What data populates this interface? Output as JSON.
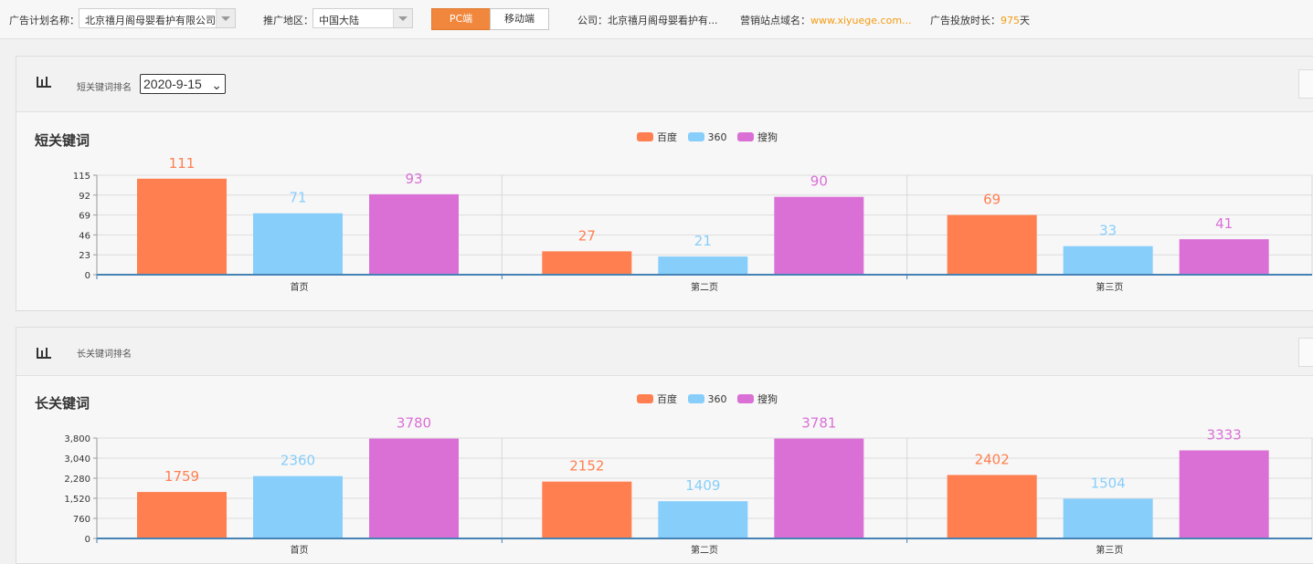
{
  "topbar": {
    "plan_label": "广告计划名称：",
    "plan_value": "北京禧月阁母婴看护有限公司(",
    "region_label": "推广地区：",
    "region_value": "中国大陆",
    "tab_pc": "PC端",
    "tab_mobile": "移动端",
    "company_label": "公司：",
    "company_value": "北京禧月阁母婴看护有...",
    "domain_label": "营销站点域名：",
    "domain_value": "www.xiyuege.com...",
    "duration_label": "广告投放时长：",
    "duration_days": "975",
    "duration_unit": "天"
  },
  "panels": [
    {
      "head_label": "短关键词排名",
      "date_value": "2020-9-15",
      "chevron": "⌄",
      "chart_icon": "bar-chart-icon"
    },
    {
      "head_label": "长关键词排名",
      "chart_icon": "bar-chart-icon"
    }
  ],
  "colors": {
    "baidu": "#ff7f50",
    "s360": "#87cefa",
    "sogou": "#da70d6",
    "accent": "#f0873d",
    "axis": "#4682b4"
  },
  "chart_data": [
    {
      "type": "bar",
      "title": "短关键词",
      "categories": [
        "首页",
        "第二页",
        "第三页"
      ],
      "series": [
        {
          "name": "百度",
          "values": [
            111,
            27,
            69
          ]
        },
        {
          "name": "360",
          "values": [
            71,
            21,
            33
          ]
        },
        {
          "name": "搜狗",
          "values": [
            93,
            90,
            41
          ]
        }
      ],
      "ylim": [
        0,
        115
      ],
      "yticks": [
        0,
        23,
        46,
        69,
        92,
        115
      ],
      "ytick_labels": [
        "0",
        "23",
        "46",
        "69",
        "92",
        "115"
      ],
      "legend": "top-center",
      "grid": true
    },
    {
      "type": "bar",
      "title": "长关键词",
      "categories": [
        "首页",
        "第二页",
        "第三页"
      ],
      "series": [
        {
          "name": "百度",
          "values": [
            1759,
            2152,
            2402
          ]
        },
        {
          "name": "360",
          "values": [
            2360,
            1409,
            1504
          ]
        },
        {
          "name": "搜狗",
          "values": [
            3780,
            3781,
            3333
          ]
        }
      ],
      "ylim": [
        0,
        3800
      ],
      "yticks": [
        0,
        760,
        1520,
        2280,
        3040,
        3800
      ],
      "ytick_labels": [
        "0",
        "760",
        "1,520",
        "2,280",
        "3,040",
        "3,800"
      ],
      "legend": "top-center",
      "grid": true
    }
  ]
}
